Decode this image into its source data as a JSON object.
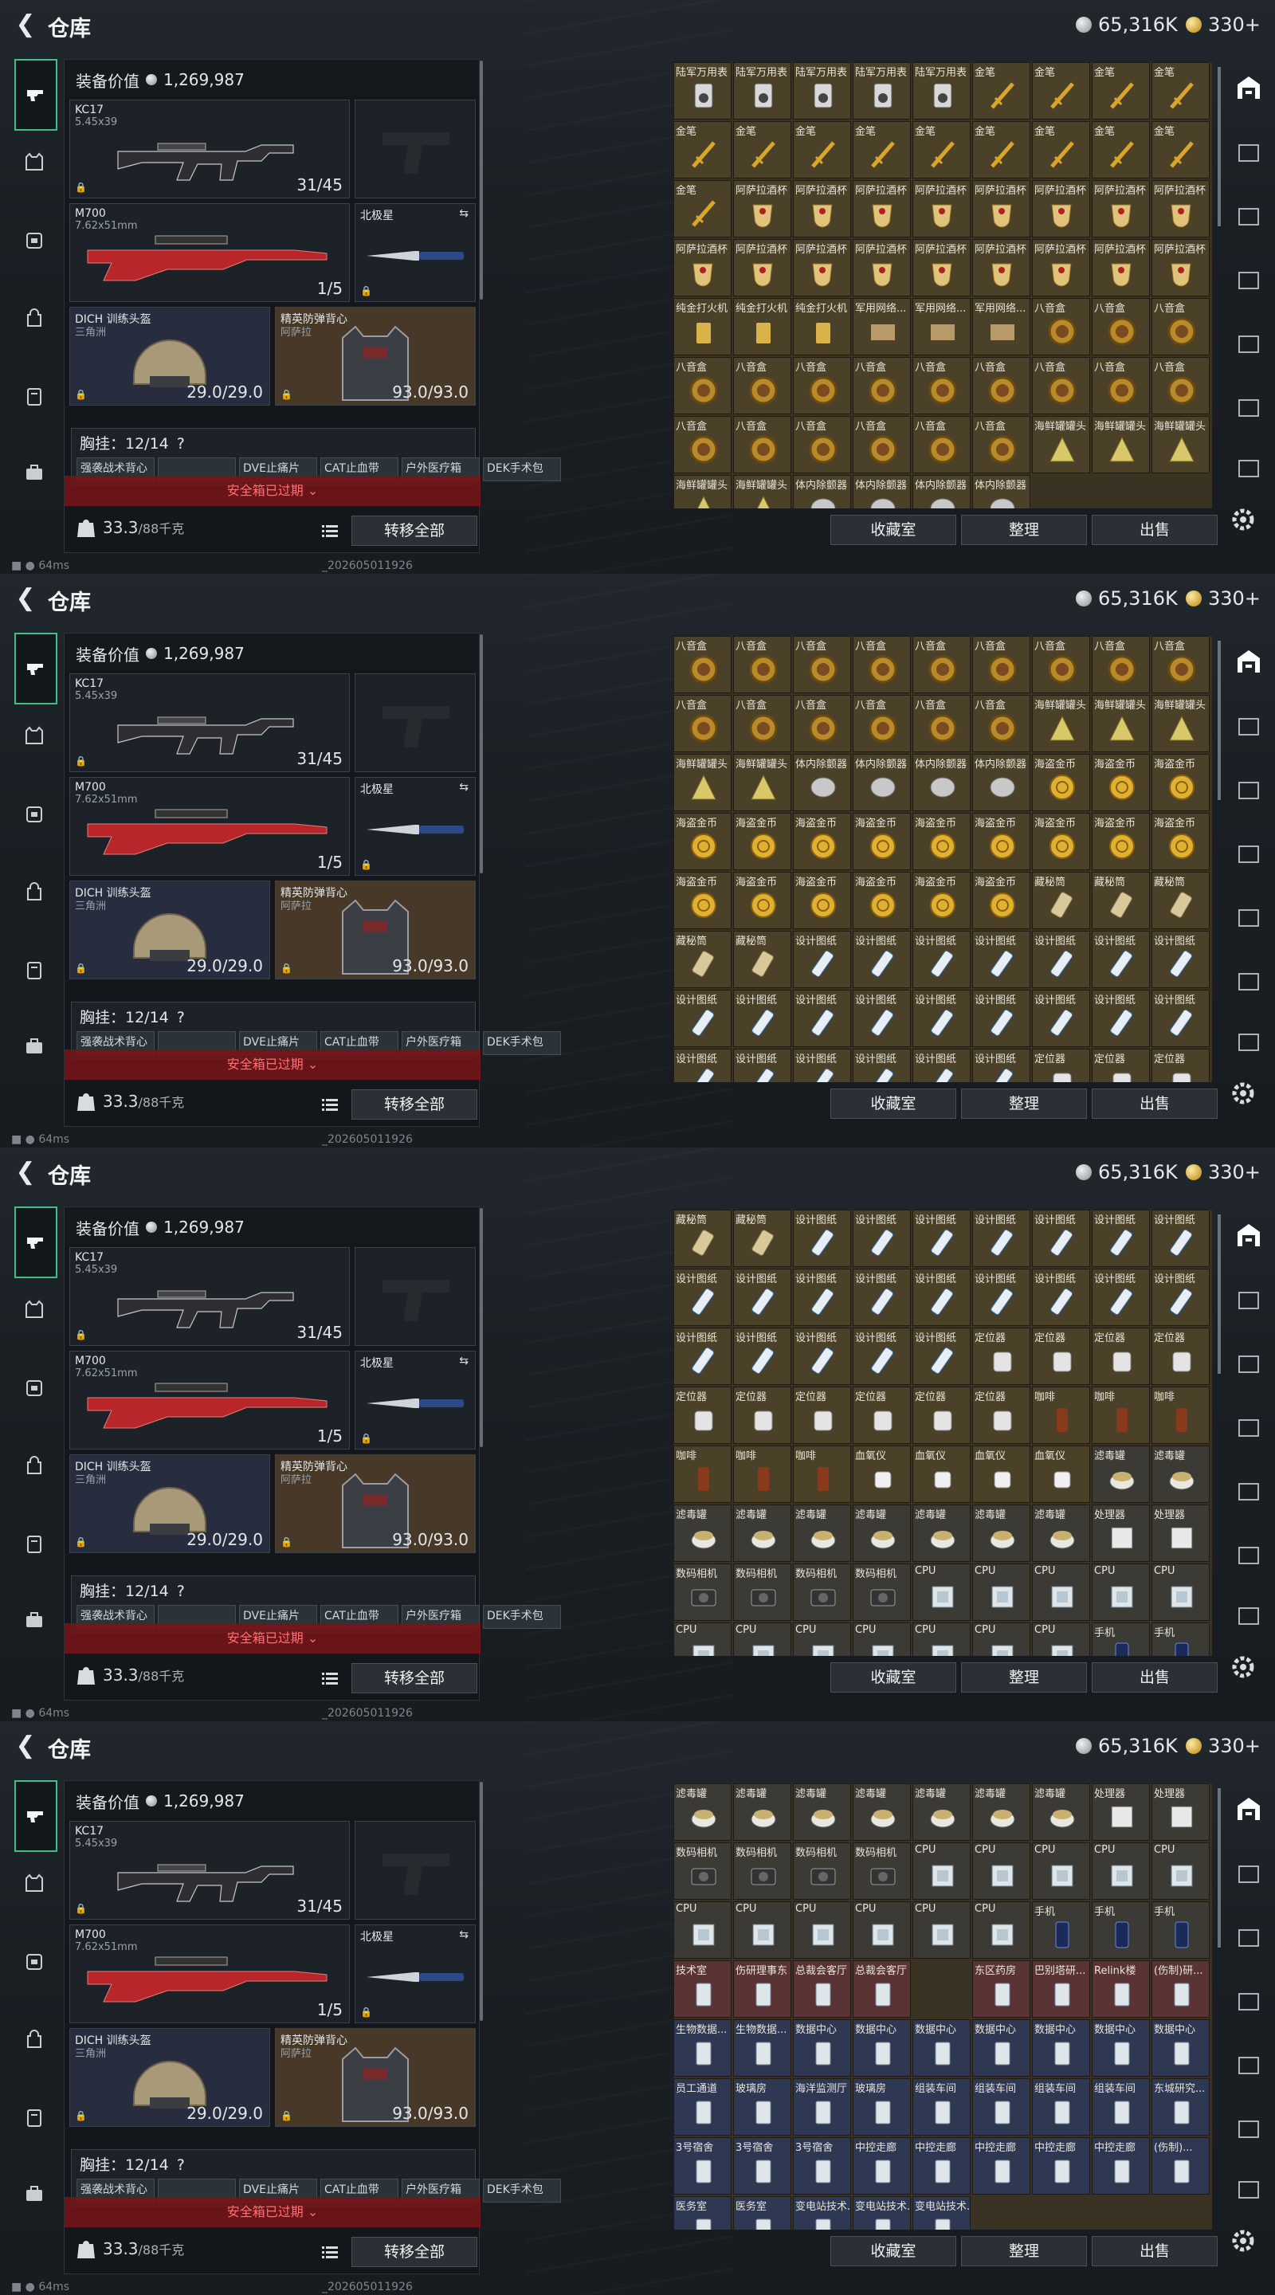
{
  "title": "仓库",
  "currency": {
    "silver": "65,316K",
    "gold": "330+"
  },
  "loadout": {
    "value_label": "装备价值",
    "value": "1,269,987",
    "primary": {
      "name": "KC17",
      "ammo": "5.45x39",
      "count": "31/45"
    },
    "secondary": {
      "name": "M700",
      "ammo": "7.62x51mm",
      "count": "1/5"
    },
    "melee": {
      "name": "北极星"
    },
    "helmet": {
      "name": "DICH 训练头盔",
      "sub": "三角洲",
      "durability": "29.0/29.0"
    },
    "armor": {
      "name": "精英防弹背心",
      "sub": "阿萨拉",
      "durability": "93.0/93.0"
    },
    "chest_label": "胸挂：12/14",
    "chest_help": "?",
    "chest_items": [
      "强袭战术背心",
      "",
      "DVE止痛片",
      "CAT止血带",
      "户外医疗箱",
      "DEK手术包"
    ],
    "safe_box": "安全箱已过期",
    "weight": "33.3",
    "weight_max": "/88千克",
    "transfer_label": "转移全部",
    "ping": "64ms",
    "build": "_202605011926"
  },
  "actions": {
    "collect": "收藏室",
    "sort": "整理",
    "sell": "出售"
  },
  "icons": {
    "back": "back-arrow-icon",
    "weapon_tab": "gun-icon",
    "list": "list-icon",
    "gear": "gear-icon"
  },
  "frames": [
    {
      "rows": [
        [
          "陆军万用表",
          "陆军万用表",
          "陆军万用表",
          "陆军万用表",
          "陆军万用表",
          "金笔",
          "金笔",
          "金笔",
          "金笔"
        ],
        [
          "金笔",
          "金笔",
          "金笔",
          "金笔",
          "金笔",
          "金笔",
          "金笔",
          "金笔",
          "金笔"
        ],
        [
          "金笔",
          "阿萨拉酒杯",
          "阿萨拉酒杯",
          "阿萨拉酒杯",
          "阿萨拉酒杯",
          "阿萨拉酒杯",
          "阿萨拉酒杯",
          "阿萨拉酒杯",
          "阿萨拉酒杯"
        ],
        [
          "阿萨拉酒杯",
          "阿萨拉酒杯",
          "阿萨拉酒杯",
          "阿萨拉酒杯",
          "阿萨拉酒杯",
          "阿萨拉酒杯",
          "阿萨拉酒杯",
          "阿萨拉酒杯",
          "阿萨拉酒杯"
        ],
        [
          "纯金打火机",
          "纯金打火机",
          "纯金打火机",
          "军用网络...",
          "军用网络...",
          "军用网络...",
          "八音盒",
          "八音盒",
          "八音盒"
        ],
        [
          "八音盒",
          "八音盒",
          "八音盒",
          "八音盒",
          "八音盒",
          "八音盒",
          "八音盒",
          "八音盒",
          "八音盒"
        ],
        [
          "八音盒",
          "八音盒",
          "八音盒",
          "八音盒",
          "八音盒",
          "八音盒",
          "海鲜罐罐头",
          "海鲜罐罐头",
          "海鲜罐罐头"
        ],
        [
          "海鲜罐罐头",
          "海鲜罐罐头",
          "体内除颤器",
          "体内除颤器",
          "体内除颤器",
          "体内除颤器",
          "",
          "",
          ""
        ]
      ]
    },
    {
      "rows": [
        [
          "八音盒",
          "八音盒",
          "八音盒",
          "八音盒",
          "八音盒",
          "八音盒",
          "八音盒",
          "八音盒",
          "八音盒"
        ],
        [
          "八音盒",
          "八音盒",
          "八音盒",
          "八音盒",
          "八音盒",
          "八音盒",
          "海鲜罐罐头",
          "海鲜罐罐头",
          "海鲜罐罐头"
        ],
        [
          "海鲜罐罐头",
          "海鲜罐罐头",
          "体内除颤器",
          "体内除颤器",
          "体内除颤器",
          "体内除颤器",
          "海盗金币",
          "海盗金币",
          "海盗金币"
        ],
        [
          "海盗金币",
          "海盗金币",
          "海盗金币",
          "海盗金币",
          "海盗金币",
          "海盗金币",
          "海盗金币",
          "海盗金币",
          "海盗金币"
        ],
        [
          "海盗金币",
          "海盗金币",
          "海盗金币",
          "海盗金币",
          "海盗金币",
          "海盗金币",
          "藏秘筒",
          "藏秘筒",
          "藏秘筒"
        ],
        [
          "藏秘筒",
          "藏秘筒",
          "设计图纸",
          "设计图纸",
          "设计图纸",
          "设计图纸",
          "设计图纸",
          "设计图纸",
          "设计图纸"
        ],
        [
          "设计图纸",
          "设计图纸",
          "设计图纸",
          "设计图纸",
          "设计图纸",
          "设计图纸",
          "设计图纸",
          "设计图纸",
          "设计图纸"
        ],
        [
          "设计图纸",
          "设计图纸",
          "设计图纸",
          "设计图纸",
          "设计图纸",
          "设计图纸",
          "定位器",
          "定位器",
          "定位器"
        ]
      ]
    },
    {
      "rows": [
        [
          "藏秘筒",
          "藏秘筒",
          "设计图纸",
          "设计图纸",
          "设计图纸",
          "设计图纸",
          "设计图纸",
          "设计图纸",
          "设计图纸"
        ],
        [
          "设计图纸",
          "设计图纸",
          "设计图纸",
          "设计图纸",
          "设计图纸",
          "设计图纸",
          "设计图纸",
          "设计图纸",
          "设计图纸"
        ],
        [
          "设计图纸",
          "设计图纸",
          "设计图纸",
          "设计图纸",
          "设计图纸",
          "定位器",
          "定位器",
          "定位器",
          "定位器"
        ],
        [
          "定位器",
          "定位器",
          "定位器",
          "定位器",
          "定位器",
          "定位器",
          "咖啡",
          "咖啡",
          "咖啡"
        ],
        [
          "咖啡",
          "咖啡",
          "咖啡",
          "血氧仪",
          "血氧仪",
          "血氧仪",
          "血氧仪",
          "滤毒罐",
          "滤毒罐"
        ],
        [
          "滤毒罐",
          "滤毒罐",
          "滤毒罐",
          "滤毒罐",
          "滤毒罐",
          "滤毒罐",
          "滤毒罐",
          "处理器",
          "处理器"
        ],
        [
          "数码相机",
          "数码相机",
          "数码相机",
          "数码相机",
          "CPU",
          "CPU",
          "CPU",
          "CPU",
          "CPU"
        ],
        [
          "CPU",
          "CPU",
          "CPU",
          "CPU",
          "CPU",
          "CPU",
          "CPU",
          "手机",
          "手机"
        ]
      ]
    },
    {
      "rows": [
        [
          "滤毒罐",
          "滤毒罐",
          "滤毒罐",
          "滤毒罐",
          "滤毒罐",
          "滤毒罐",
          "滤毒罐",
          "处理器",
          "处理器"
        ],
        [
          "数码相机",
          "数码相机",
          "数码相机",
          "数码相机",
          "CPU",
          "CPU",
          "CPU",
          "CPU",
          "CPU"
        ],
        [
          "CPU",
          "CPU",
          "CPU",
          "CPU",
          "CPU",
          "CPU",
          "手机",
          "手机",
          "手机"
        ],
        [
          "技术室",
          "伤研理事东",
          "总裁会客厅",
          "总裁会客厅",
          "",
          "东区药房",
          "巴别塔研...",
          "Relink楼",
          "(伤制)研..."
        ],
        [
          "生物数据...",
          "生物数据...",
          "数据中心",
          "数据中心",
          "数据中心",
          "数据中心",
          "数据中心",
          "数据中心",
          "数据中心"
        ],
        [
          "员工通道",
          "玻璃房",
          "海洋监测厅",
          "玻璃房",
          "组装车间",
          "组装车间",
          "组装车间",
          "组装车间",
          "东城研究..."
        ],
        [
          "3号宿舍",
          "3号宿舍",
          "3号宿舍",
          "中控走廊",
          "中控走廊",
          "中控走廊",
          "中控走廊",
          "中控走廊",
          "(伤制)..."
        ],
        [
          "医务室",
          "医务室",
          "变电站技术...",
          "变电站技术...",
          "变电站技术...",
          "",
          "",
          "",
          ""
        ]
      ]
    }
  ]
}
